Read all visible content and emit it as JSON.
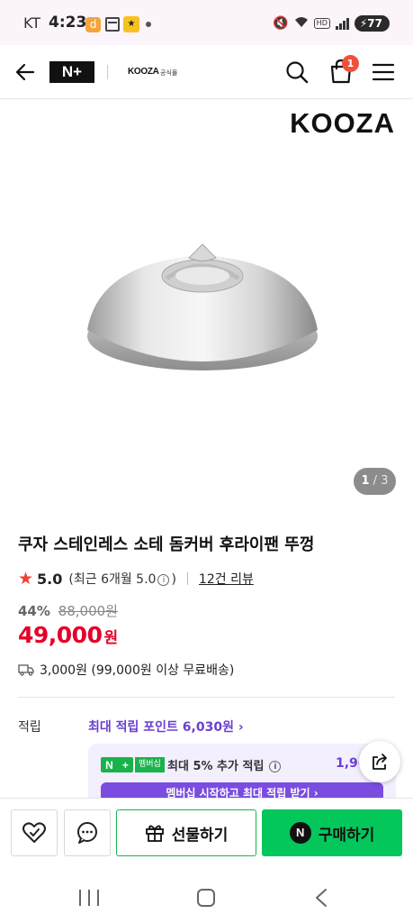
{
  "status_bar": {
    "carrier": "KT",
    "time": "4:23",
    "battery": "77"
  },
  "header": {
    "brand_small": "KOOZA",
    "brand_small_sub": "공식몰",
    "cart_count": "1",
    "nplus_logo": "N+"
  },
  "product": {
    "brand_logo": "KOOZA",
    "image_counter_current": "1",
    "image_counter_sep": " / ",
    "image_counter_total": "3",
    "title": "쿠자 스테인레스 소테 돔커버 후라이팬 뚜껑",
    "rating_score": "5.0",
    "rating_detail_prefix": "(최근 6개월 5.0",
    "rating_detail_suffix": ")",
    "review_link": "12건 리뷰",
    "discount_rate": "44%",
    "original_price": "88,000원",
    "price": "49,000",
    "price_unit": "원",
    "delivery": "3,000원 (99,000원 이상 무료배송)"
  },
  "points": {
    "label": "적립",
    "link": "최대 적립 포인트 6,030원 ›"
  },
  "membership": {
    "tag": "멤버십",
    "text": "최대 5% 추가 적립",
    "amount": "1,96",
    "cta": "멤버십 시작하고 최대 적립 받기 ›"
  },
  "actions": {
    "gift_label": "선물하기",
    "buy_label": "구매하기",
    "buy_logo": "N"
  },
  "colors": {
    "accent_green": "#03c75a",
    "price_red": "#e5002a",
    "points_purple": "#6a3fd1"
  }
}
